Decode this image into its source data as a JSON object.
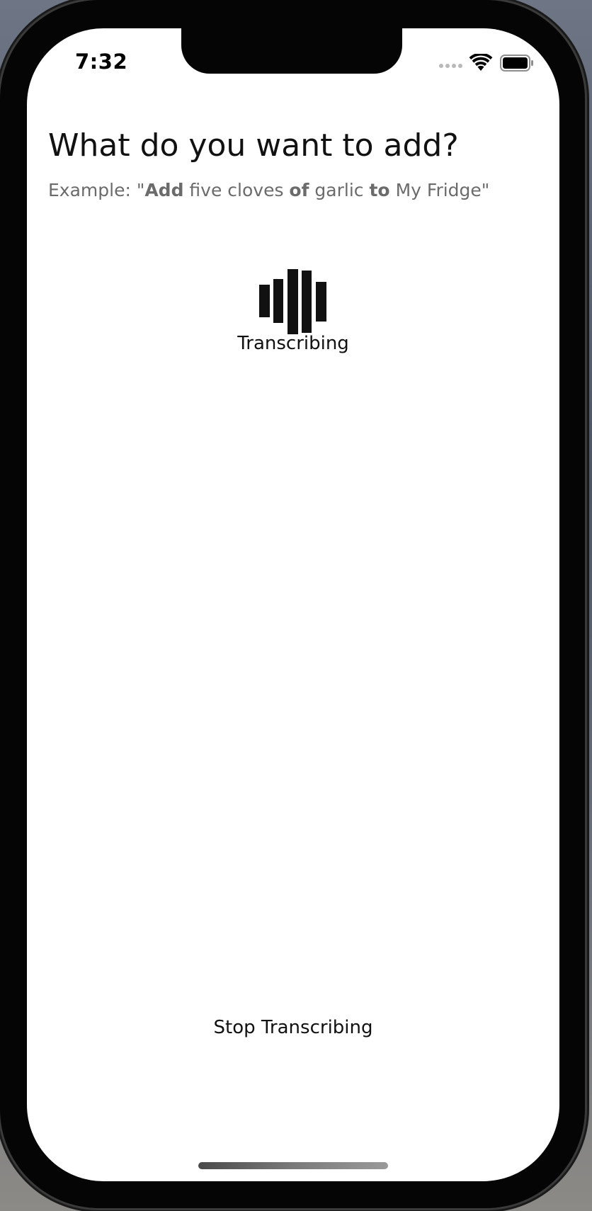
{
  "status_bar": {
    "time": "7:32",
    "signal_icon": "signal-dots-icon",
    "wifi_icon": "wifi-icon",
    "battery_icon": "battery-icon"
  },
  "header": {
    "title": "What do you want to add?",
    "example_prefix": "Example: \"",
    "example_word_add": "Add",
    "example_part1": " five cloves ",
    "example_word_of": "of",
    "example_part2": " garlic ",
    "example_word_to": "to",
    "example_part3": " My Fridge\""
  },
  "transcription": {
    "icon": "waveform-icon",
    "status_label": "Transcribing"
  },
  "footer": {
    "stop_label": "Stop Transcribing"
  },
  "colors": {
    "text_primary": "#111111",
    "text_secondary": "#6b6b6b",
    "background": "#ffffff"
  }
}
